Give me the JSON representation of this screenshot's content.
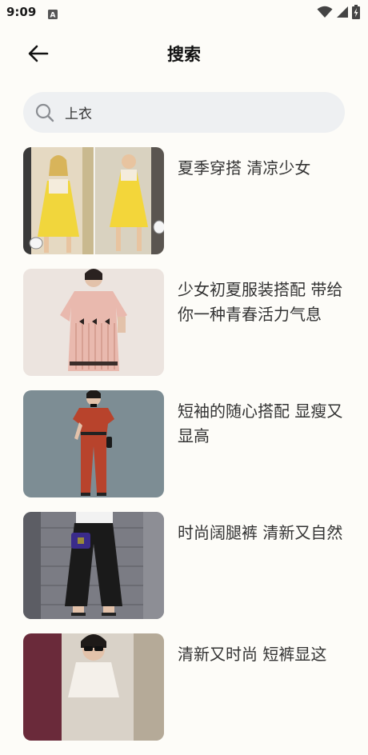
{
  "status_bar": {
    "time": "9:09",
    "notification_icon": "text-notification-icon",
    "icons": [
      "wifi-icon",
      "cellular-signal-icon",
      "battery-charging-icon"
    ]
  },
  "header": {
    "title": "搜索",
    "back_icon": "arrow-left-icon"
  },
  "search": {
    "value": "上衣",
    "icon": "search-icon"
  },
  "results": [
    {
      "title": "夏季穿搭 清凉少女",
      "thumb": "yellow-dress-photo"
    },
    {
      "title": "少女初夏服装搭配 带给你一种青春活力气息",
      "thumb": "pink-striped-dress-photo"
    },
    {
      "title": "短袖的随心搭配 显瘦又显高",
      "thumb": "rust-red-outfit-photo"
    },
    {
      "title": "时尚阔腿裤  清新又自然",
      "thumb": "black-wide-leg-pants-photo"
    },
    {
      "title": "清新又时尚  短裤显这",
      "thumb": "sunglasses-outfit-photo"
    }
  ],
  "colors": {
    "background": "#fdfcf8",
    "search_bg": "#eef0f2",
    "text": "#333333"
  }
}
